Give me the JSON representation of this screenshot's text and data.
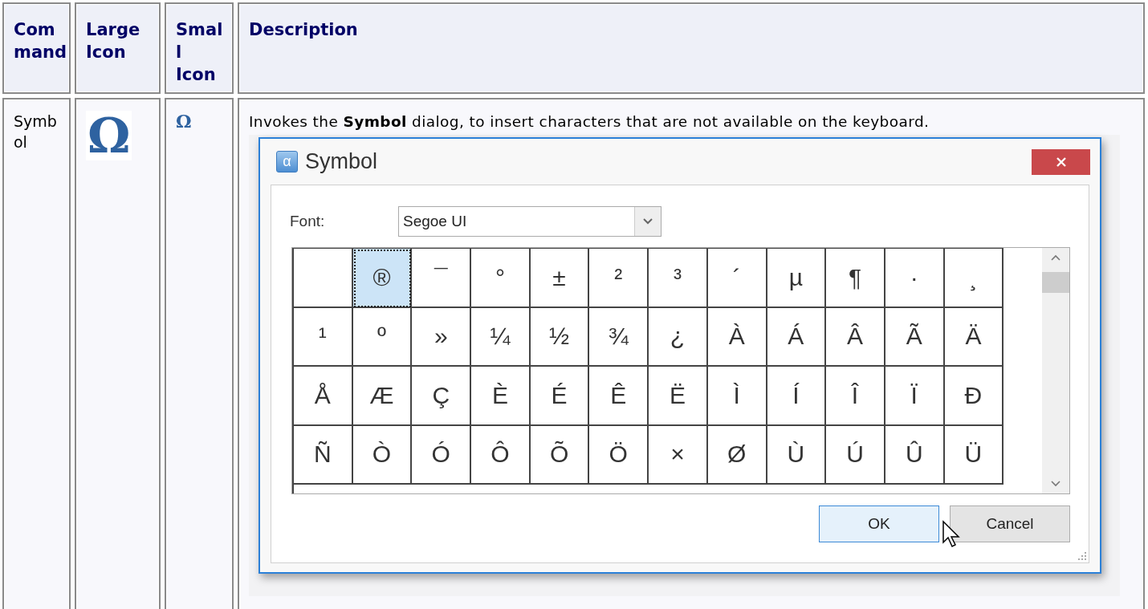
{
  "table": {
    "columns": [
      "Command",
      "Large Icon",
      "Small Icon",
      "Description"
    ],
    "rows": [
      {
        "command": "Symbol",
        "large_icon": "Ω",
        "small_icon": "Ω",
        "description": "Invokes the **Symbol** dialog, to insert characters that are not available on the keyboard.",
        "dialog": {
          "title_icon": "α",
          "title": "Symbol",
          "font_label": "Font:",
          "font_value": "Segoe UI",
          "characters": [
            {
              "selected": false
            },
            {
              "char": "®",
              "selected": true
            },
            {
              "char": "¯",
              "selected": false
            },
            {
              "char": "°",
              "selected": false
            },
            {
              "char": "±",
              "selected": false
            },
            {
              "char": "²",
              "selected": false
            },
            {
              "char": "³",
              "selected": false
            },
            {
              "char": "´",
              "selected": false
            },
            {
              "char": "µ",
              "selected": false
            },
            {
              "char": "¶",
              "selected": false
            },
            {
              "char": "·",
              "selected": false
            },
            {
              "char": "¸",
              "selected": false
            },
            {
              "char": "¹",
              "selected": false
            },
            {
              "char": "º",
              "selected": false
            },
            {
              "char": "»",
              "selected": false
            },
            {
              "char": "¼",
              "selected": false
            },
            {
              "char": "½",
              "selected": false
            },
            {
              "char": "¾",
              "selected": false
            },
            {
              "char": "¿",
              "selected": false
            },
            {
              "char": "À",
              "selected": false
            },
            {
              "char": "Á",
              "selected": false
            },
            {
              "char": "Â",
              "selected": false
            },
            {
              "char": "Ã",
              "selected": false
            },
            {
              "char": "Ä",
              "selected": false
            },
            {
              "char": "Å",
              "selected": false
            },
            {
              "char": "Æ",
              "selected": false
            },
            {
              "char": "Ç",
              "selected": false
            },
            {
              "char": "È",
              "selected": false
            },
            {
              "char": "É",
              "selected": false
            },
            {
              "char": "Ê",
              "selected": false
            },
            {
              "char": "Ë",
              "selected": false
            },
            {
              "char": "Ì",
              "selected": false
            },
            {
              "char": "Í",
              "selected": false
            },
            {
              "char": "Î",
              "selected": false
            },
            {
              "char": "Ï",
              "selected": false
            },
            {
              "char": "Ð",
              "selected": false
            },
            {
              "char": "Ñ",
              "selected": false
            },
            {
              "char": "Ò",
              "selected": false
            },
            {
              "char": "Ó",
              "selected": false
            },
            {
              "char": "Ô",
              "selected": false
            },
            {
              "char": "Õ",
              "selected": false
            },
            {
              "char": "Ö",
              "selected": false
            },
            {
              "char": "×",
              "selected": false
            },
            {
              "char": "Ø",
              "selected": false
            },
            {
              "char": "Ù",
              "selected": false
            },
            {
              "char": "Ú",
              "selected": false
            },
            {
              "char": "Û",
              "selected": false
            },
            {
              "char": "Ü",
              "selected": false
            }
          ],
          "buttons": [
            {
              "label": "OK",
              "kind": "default"
            },
            {
              "label": "Cancel",
              "kind": "normal"
            }
          ]
        }
      }
    ]
  }
}
